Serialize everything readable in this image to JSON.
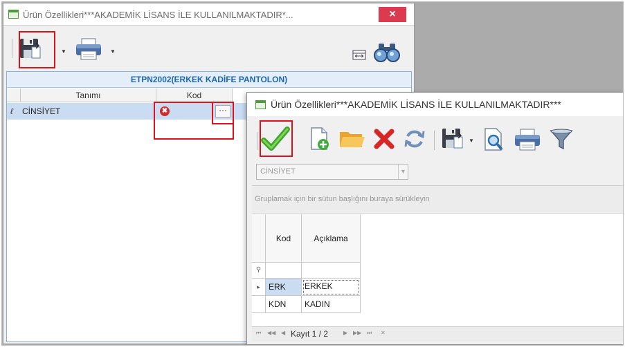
{
  "window_back": {
    "title": "Ürün Özellikleri***AKADEMİK LİSANS İLE KULLANILMAKTADIR*...",
    "close_label": "×",
    "grid": {
      "group_header": "ETPN2002(ERKEK KADİFE PANTOLON)",
      "columns": [
        "Tanımı",
        "Kod"
      ],
      "row": {
        "indicator": "ℓ",
        "tanimi": "CİNSİYET",
        "kod_error": "✖",
        "ellipsis": "···"
      }
    }
  },
  "window_front": {
    "title": "Ürün Özellikleri***AKADEMİK LİSANS İLE KULLANILMAKTADIR***",
    "combo": {
      "value": "CİNSİYET"
    },
    "group_panel_text": "Gruplamak için bir sütun başlığını buraya sürükleyin",
    "columns": [
      "Kod",
      "Açıklama"
    ],
    "filter_row_icon": "⚲",
    "rows": [
      {
        "indicator": "▸",
        "kod": "ERK",
        "aciklama": "ERKEK"
      },
      {
        "indicator": "",
        "kod": "KDN",
        "aciklama": "KADIN"
      }
    ],
    "navigator": {
      "label": "Kayıt 1 / 2"
    }
  },
  "icons": {
    "save": "floppy-disk-icon",
    "print": "printer-icon",
    "find": "binoculars-icon",
    "check": "checkmark-icon",
    "new": "new-document-icon",
    "open": "folder-icon",
    "delete": "delete-x-icon",
    "refresh": "refresh-icon",
    "preview": "print-preview-icon",
    "filter": "funnel-icon"
  },
  "colors": {
    "highlight_box": "#e0101a",
    "close_button": "#dc3b4f",
    "selection": "#c9dcf2",
    "group_header_text": "#1d66b0"
  }
}
